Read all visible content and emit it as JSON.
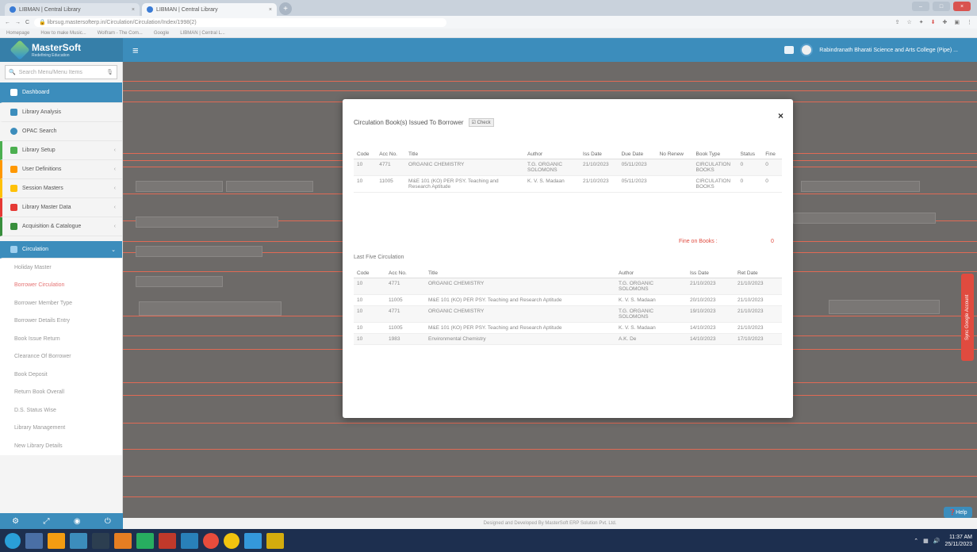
{
  "browser": {
    "tabs": [
      {
        "label": "LIBMAN | Central Library"
      },
      {
        "label": "LIBMAN | Central Library"
      }
    ],
    "url": "librsug.mastersofterp.in/Circulation/Circulation/Index/1998(2)",
    "bookmarks": [
      "Homepage",
      "How to make Music...",
      "Wolfram - The Com...",
      "Google",
      "LIBMAN | Central L..."
    ]
  },
  "header": {
    "logo_title": "MasterSoft",
    "logo_subtitle": "Redefining Education",
    "college_name": "Rabindranath Bharati Science and Arts College (Pipe) ..."
  },
  "sidebar": {
    "search_placeholder": "Search Menu/Menu Items",
    "items": [
      {
        "label": "Dashboard",
        "color": "#3c8dbc"
      },
      {
        "label": "Library Analysis",
        "color": "#3c8dbc"
      },
      {
        "label": "OPAC Search",
        "color": "#3c8dbc"
      },
      {
        "label": "Library Setup",
        "color": "#4caf50"
      },
      {
        "label": "User Definitions",
        "color": "#ff9800"
      },
      {
        "label": "Session Masters",
        "color": "#ffc107"
      },
      {
        "label": "Library Master Data",
        "color": "#e53935"
      },
      {
        "label": "Acquisition & Catalogue",
        "color": "#388e3c"
      }
    ],
    "circulation_label": "Circulation",
    "sub_items": [
      "Holiday Master",
      "Borrower Circulation",
      "Borrower Member Type",
      "Borrower Details Entry",
      "Book Issue Return",
      "Clearance Of Borrower",
      "Book Deposit",
      "Return Book Overall",
      "D.S. Status Wise",
      "Library Management",
      "New Library Details"
    ]
  },
  "footer_text": "Designed and Developed By MasterSoft ERP Solution Pvt. Ltd.",
  "signin_tab": "Sync Google Account",
  "help_label": "Help",
  "modal": {
    "title": "Circulation Book(s) Issued To Borrower",
    "check_label": "Check",
    "close": "×",
    "issued_headers": [
      "Code",
      "Acc No.",
      "Title",
      "Author",
      "Iss Date",
      "Due Date",
      "No Renew",
      "Book Type",
      "Status",
      "Fine"
    ],
    "issued_rows": [
      [
        "10",
        "4771",
        "ORGANIC CHEMISTRY",
        "T.G. ORGANIC SOLOMONS",
        "21/10/2023",
        "05/11/2023",
        "",
        "CIRCULATION BOOKS",
        "0",
        "0"
      ],
      [
        "10",
        "11005",
        "M&E 101 (KO) PER PSY. Teaching and Research Aptitude",
        "K. V. S. Madaan",
        "21/10/2023",
        "05/11/2023",
        "",
        "CIRCULATION BOOKS",
        "0",
        "0"
      ]
    ],
    "fine_label": "Fine on Books :",
    "fine_value": "0",
    "last_five_label": "Last Five Circulation",
    "history_headers": [
      "Code",
      "Acc No.",
      "Title",
      "Author",
      "Iss Date",
      "Ret Date"
    ],
    "history_rows": [
      [
        "10",
        "4771",
        "ORGANIC CHEMISTRY",
        "T.G. ORGANIC SOLOMONS",
        "21/10/2023",
        "21/10/2023"
      ],
      [
        "10",
        "11005",
        "M&E 101 (KO) PER PSY. Teaching and Research Aptitude",
        "K. V. S. Madaan",
        "20/10/2023",
        "21/10/2023"
      ],
      [
        "10",
        "4771",
        "ORGANIC CHEMISTRY",
        "T.G. ORGANIC SOLOMONS",
        "19/10/2023",
        "21/10/2023"
      ],
      [
        "10",
        "11005",
        "M&E 101 (KO) PER PSY. Teaching and Research Aptitude",
        "K. V. S. Madaan",
        "14/10/2023",
        "21/10/2023"
      ],
      [
        "10",
        "1983",
        "Environmental Chemistry",
        "A.K. De",
        "14/10/2023",
        "17/10/2023"
      ]
    ]
  },
  "taskbar": {
    "time": "11:37 AM",
    "date": "25/11/2023"
  }
}
